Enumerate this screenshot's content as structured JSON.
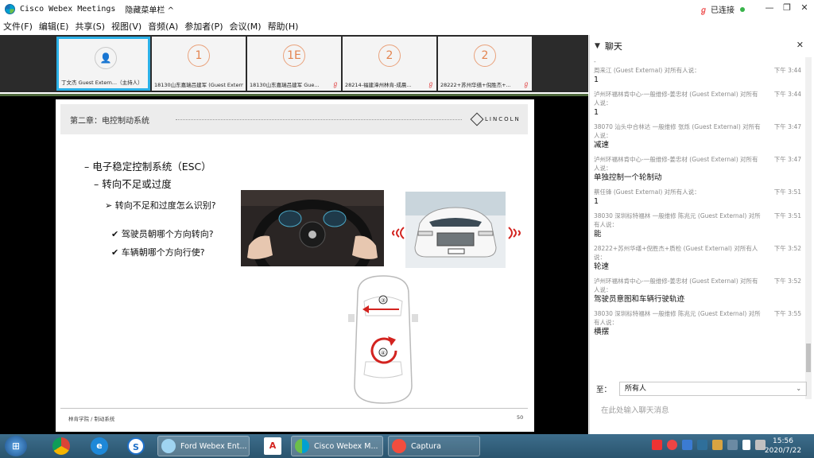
{
  "titlebar": {
    "app_title": "Cisco Webex Meetings",
    "hide_menu_label": "隐藏菜单栏 ^",
    "status_label": "已连接"
  },
  "menu": [
    "文件(F)",
    "编辑(E)",
    "共享(S)",
    "视图(V)",
    "音频(A)",
    "参加者(P)",
    "会议(M)",
    "帮助(H)"
  ],
  "participants": [
    {
      "avatar": "",
      "name": "丁文杰 Guest Extern...（主持人）"
    },
    {
      "avatar": "1",
      "name": "18130山东嘉瑞吕建军 (Guest External)"
    },
    {
      "avatar": "1E",
      "name": "18130山东嘉瑞吕建军 Gue..."
    },
    {
      "avatar": "2",
      "name": "28214-福建漳州林肯-成晨..."
    },
    {
      "avatar": "2",
      "name": "28222+苏州华缮+倪胜杰+..."
    }
  ],
  "slide": {
    "chapter": "第二章：电控制动系统",
    "brand": "LINCOLN",
    "bullet1": "– 电子稳定控制系统（ESC）",
    "bullet2": "– 转向不足或过度",
    "bullet3": "➢  转向不足和过度怎么识别?",
    "bullet4": "✔  驾驶员朝哪个方向转向?",
    "bullet5": "✔  车辆朝哪个方向行使?",
    "diagram_label_top": "③",
    "diagram_label_bottom": "④",
    "footer": "林肯学院 / 制动系统",
    "page": "50"
  },
  "chat": {
    "title": "聊天",
    "messages": [
      {
        "sender": "-",
        "time": "",
        "text": ""
      },
      {
        "sender": "周来江 (Guest External) 对所有人说：",
        "time": "下午 3:44",
        "text": "1"
      },
      {
        "sender": "泸州环福林肯中心-一般维修-姜忠材 (Guest External) 对所有人说：",
        "time": "下午 3:44",
        "text": "1"
      },
      {
        "sender": "38070 汕头中合林达 一般维修 张烁 (Guest External) 对所有人说：",
        "time": "下午 3:47",
        "text": "减速"
      },
      {
        "sender": "泸州环福林肯中心-一般维修-姜忠材 (Guest External) 对所有人说：",
        "time": "下午 3:47",
        "text": "单独控制一个轮制动"
      },
      {
        "sender": "蔡任锋 (Guest External) 对所有人说：",
        "time": "下午 3:51",
        "text": "1"
      },
      {
        "sender": "38030 深圳标特福林 一般维修 陈兆元 (Guest External) 对所有人说：",
        "time": "下午 3:51",
        "text": "能"
      },
      {
        "sender": "28222+苏州华缮+倪胜杰+质检 (Guest External) 对所有人说：",
        "time": "下午 3:52",
        "text": "轮速"
      },
      {
        "sender": "泸州环福林肯中心-一般维修-姜忠材 (Guest External) 对所有人说：",
        "time": "下午 3:52",
        "text": "驾驶员意图和车辆行驶轨迹"
      },
      {
        "sender": "38030 深圳标特福林 一般维修 陈兆元 (Guest External) 对所有人说：",
        "time": "下午 3:55",
        "text": "横摆"
      }
    ],
    "to_label": "至：",
    "to_value": "所有人",
    "input_placeholder": "在此处输入聊天消息"
  },
  "taskbar": {
    "tasks": [
      "Ford Webex Ent...",
      "Cisco Webex M...",
      "Captura"
    ],
    "time": "15:56",
    "date": "2020/7/22"
  },
  "colors": {
    "accent": "#2bb1e8",
    "status_green": "#38b34a",
    "red_arrow": "#d3231f"
  }
}
